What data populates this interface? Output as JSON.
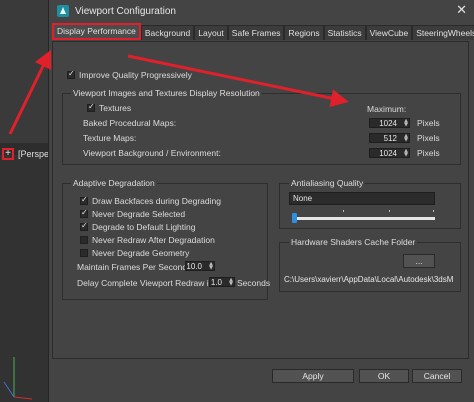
{
  "background": {
    "viewport_label": "[Perspe",
    "plus_icon": "+"
  },
  "dialog": {
    "title": "Viewport Configuration",
    "close_label": "✕",
    "tabs": [
      {
        "label": "Display Performance",
        "active": true
      },
      {
        "label": "Background"
      },
      {
        "label": "Layout"
      },
      {
        "label": "Safe Frames"
      },
      {
        "label": "Regions"
      },
      {
        "label": "Statistics"
      },
      {
        "label": "ViewCube"
      },
      {
        "label": "SteeringWheels"
      }
    ]
  },
  "display_performance": {
    "improve_quality": {
      "label": "Improve Quality Progressively",
      "checked": true
    },
    "resolution_group": {
      "title": "Viewport Images and Textures Display Resolution",
      "textures": {
        "label": "Textures",
        "checked": true
      },
      "maximum_label": "Maximum:",
      "rows": [
        {
          "label": "Baked Procedural Maps:",
          "value": "1024",
          "unit": "Pixels"
        },
        {
          "label": "Texture Maps:",
          "value": "512",
          "unit": "Pixels"
        },
        {
          "label": "Viewport Background / Environment:",
          "value": "1024",
          "unit": "Pixels"
        }
      ]
    },
    "adaptive_group": {
      "title": "Adaptive Degradation",
      "options": [
        {
          "label": "Draw Backfaces during Degrading",
          "checked": true
        },
        {
          "label": "Never Degrade Selected",
          "checked": true
        },
        {
          "label": "Degrade to Default Lighting",
          "checked": true
        },
        {
          "label": "Never Redraw After Degradation",
          "checked": false
        },
        {
          "label": "Never Degrade Geometry",
          "checked": false
        }
      ],
      "max_fps_label": "Maintain Frames Per Second:",
      "max_fps_value": "10.0",
      "delay_label": "Delay Complete Viewport Redraw in",
      "delay_value": "1.0",
      "delay_unit": "Seconds"
    },
    "antialiasing": {
      "title": "Antialiasing Quality",
      "value": "None",
      "slider_position": 0
    },
    "shader_cache": {
      "title": "Hardware Shaders Cache Folder",
      "browse_label": "...",
      "path": "C:\\Users\\xavierr\\AppData\\Local\\Autodesk\\3dsM"
    }
  },
  "footer": {
    "apply": "Apply",
    "ok": "OK",
    "cancel": "Cancel"
  },
  "colors": {
    "highlight": "#e0202a",
    "slider_thumb": "#2e8fe0",
    "dialog_bg": "#444444"
  },
  "icons": {
    "app_icon": "3dsmax-logo-icon",
    "checkmark": "check-icon"
  }
}
